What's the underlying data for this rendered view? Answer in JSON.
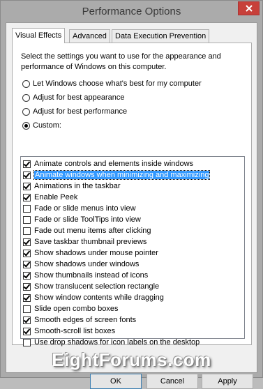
{
  "window": {
    "title": "Performance Options"
  },
  "tabs": [
    {
      "label": "Visual Effects",
      "active": true
    },
    {
      "label": "Advanced",
      "active": false
    },
    {
      "label": "Data Execution Prevention",
      "active": false
    }
  ],
  "description": "Select the settings you want to use for the appearance and performance of Windows on this computer.",
  "radios": [
    {
      "label": "Let Windows choose what's best for my computer",
      "checked": false
    },
    {
      "label": "Adjust for best appearance",
      "checked": false
    },
    {
      "label": "Adjust for best performance",
      "checked": false
    },
    {
      "label": "Custom:",
      "checked": true
    }
  ],
  "effects": [
    {
      "label": "Animate controls and elements inside windows",
      "checked": true
    },
    {
      "label": "Animate windows when minimizing and maximizing",
      "checked": true,
      "selected": true
    },
    {
      "label": "Animations in the taskbar",
      "checked": true
    },
    {
      "label": "Enable Peek",
      "checked": true
    },
    {
      "label": "Fade or slide menus into view",
      "checked": false
    },
    {
      "label": "Fade or slide ToolTips into view",
      "checked": false
    },
    {
      "label": "Fade out menu items after clicking",
      "checked": false
    },
    {
      "label": "Save taskbar thumbnail previews",
      "checked": true
    },
    {
      "label": "Show shadows under mouse pointer",
      "checked": true
    },
    {
      "label": "Show shadows under windows",
      "checked": true
    },
    {
      "label": "Show thumbnails instead of icons",
      "checked": true
    },
    {
      "label": "Show translucent selection rectangle",
      "checked": true
    },
    {
      "label": "Show window contents while dragging",
      "checked": true
    },
    {
      "label": "Slide open combo boxes",
      "checked": false
    },
    {
      "label": "Smooth edges of screen fonts",
      "checked": true
    },
    {
      "label": "Smooth-scroll list boxes",
      "checked": true
    },
    {
      "label": "Use drop shadows for icon labels on the desktop",
      "checked": false
    }
  ],
  "watermark": "EightForums.com",
  "buttons": {
    "ok": "OK",
    "cancel": "Cancel",
    "apply": "Apply"
  },
  "colors": {
    "selection": "#3399ff",
    "close": "#c7403a"
  }
}
